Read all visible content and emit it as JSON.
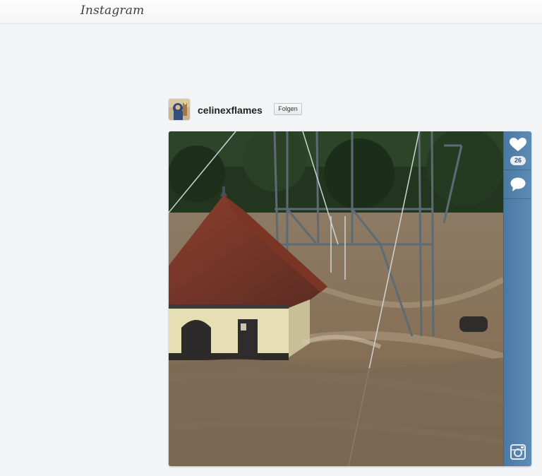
{
  "header": {
    "logo_text": "Instagram"
  },
  "post": {
    "username": "celinexflames",
    "follow_label": "Folgen",
    "likes_count": "26"
  },
  "icons": {
    "avatar": "avatar",
    "like": "heart-icon",
    "comment": "comment-icon",
    "camera": "camera-icon"
  },
  "colors": {
    "rail": "#5785b0",
    "background": "#f3f4f5",
    "water": "#8a7560"
  }
}
